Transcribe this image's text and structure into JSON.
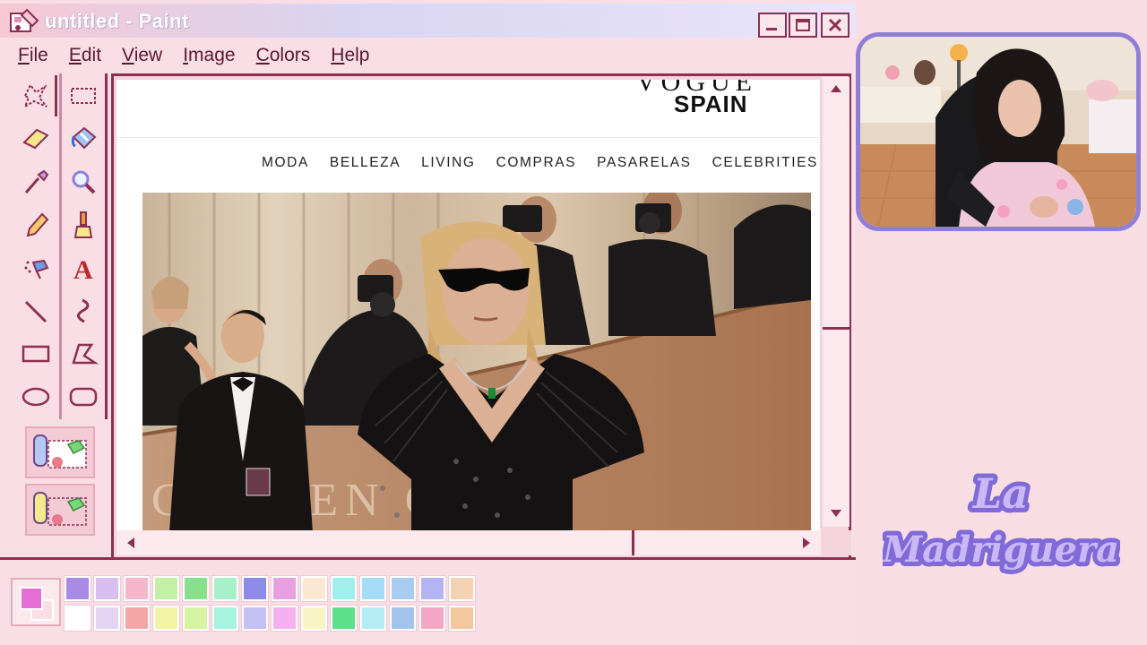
{
  "window": {
    "title": "untitled - Paint",
    "controls": {
      "minimize": "minimize",
      "maximize": "maximize",
      "close": "close"
    }
  },
  "menu": [
    {
      "label": "File",
      "accel": "F",
      "rest": "ile"
    },
    {
      "label": "Edit",
      "accel": "E",
      "rest": "dit"
    },
    {
      "label": "View",
      "accel": "V",
      "rest": "iew"
    },
    {
      "label": "Image",
      "accel": "I",
      "rest": "mage"
    },
    {
      "label": "Colors",
      "accel": "C",
      "rest": "olors"
    },
    {
      "label": "Help",
      "accel": "H",
      "rest": "elp"
    }
  ],
  "tools": [
    "free-form-select-icon",
    "rect-select-icon",
    "eraser-icon",
    "fill-bucket-icon",
    "eyedropper-icon",
    "magnifier-icon",
    "pencil-icon",
    "brush-icon",
    "airbrush-icon",
    "text-icon",
    "line-icon",
    "curve-icon",
    "rectangle-icon",
    "polygon-icon",
    "ellipse-icon",
    "rounded-rect-icon"
  ],
  "webpage": {
    "masthead_cut": "VOGUE",
    "edition": "SPAIN",
    "nav": [
      "MODA",
      "BELLEZA",
      "LIVING",
      "COMPRAS",
      "PASARELAS",
      "CELEBRITIES"
    ],
    "backdrop_text": "GOLDEN G"
  },
  "palette": {
    "foreground": "#e66fd6",
    "background": "#f9dfe5",
    "row1": [
      "#a98be6",
      "#d8bff0",
      "#f6b6cc",
      "#c4f0a6",
      "#86e08c",
      "#a8f0c8",
      "#8c8ce8",
      "#e8a0e0",
      "#fbe7d2",
      "#9ef0ec",
      "#a6dcf6",
      "#a8cdf0",
      "#b4b4f4",
      "#f6d2b4"
    ],
    "row2": [
      "#ffffff",
      "#e4d4f4",
      "#f6a6a6",
      "#f4f4a6",
      "#d4f4a0",
      "#a6f4e0",
      "#c4c0f4",
      "#f4b0f0",
      "#f8f4c4",
      "#5ce08a",
      "#b4ecf4",
      "#a4c4ec",
      "#f4a6c4",
      "#f4c89e"
    ]
  },
  "overlay": {
    "logo_line1": "La",
    "logo_line2": "Madriguera"
  }
}
